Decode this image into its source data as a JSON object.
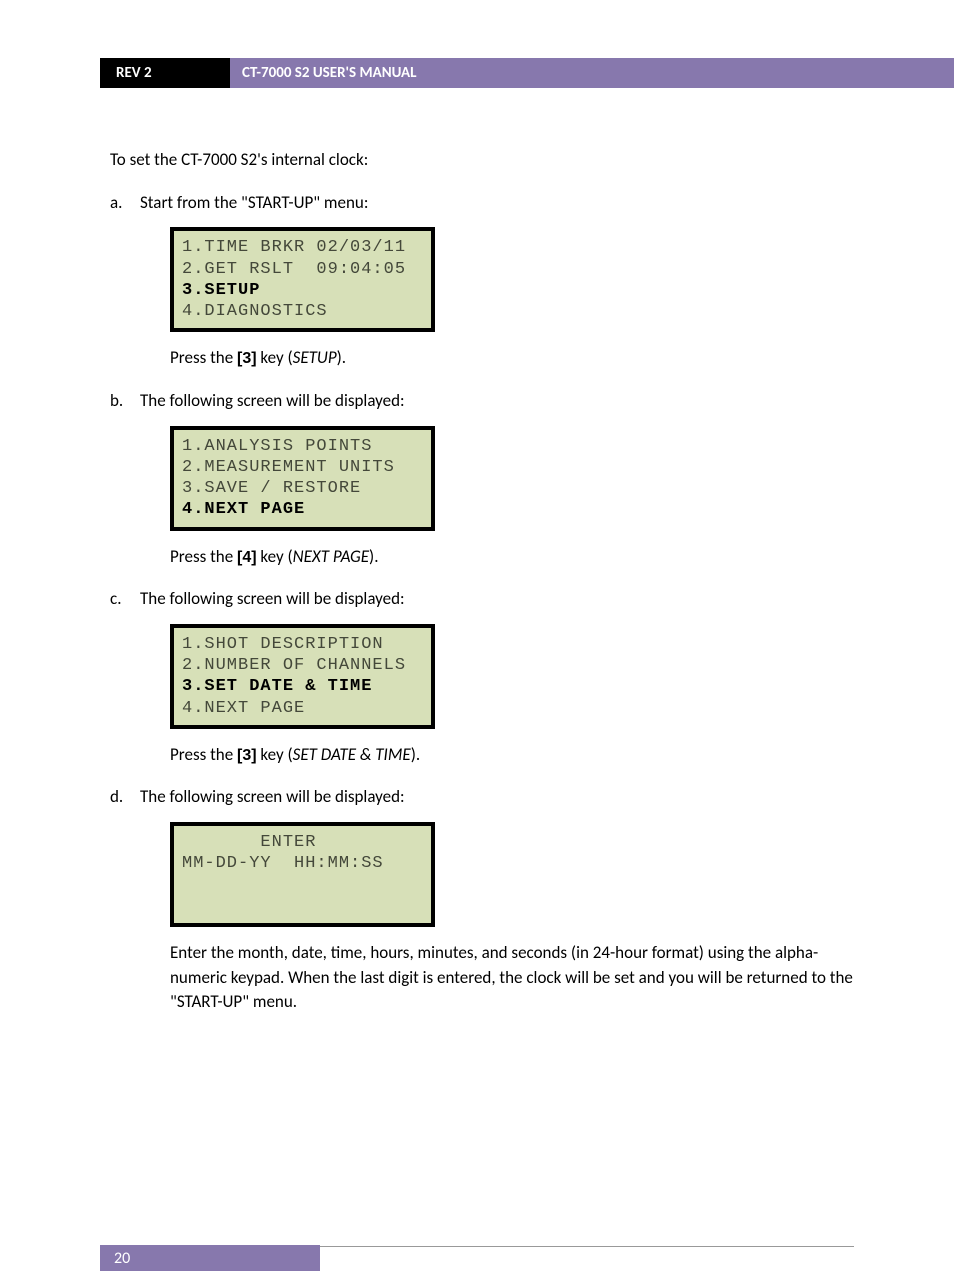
{
  "header": {
    "rev": "REV 2",
    "title": "CT-7000 S2 USER'S MANUAL"
  },
  "intro": "To set the CT-7000 S2's internal clock:",
  "steps": {
    "a": {
      "letter": "a.",
      "text": "Start from the \"START-UP\" menu:",
      "lcd": {
        "l1": "1.TIME BRKR 02/03/11",
        "l2": "2.GET RSLT  09:04:05",
        "l3": "3.SETUP",
        "l4": "4.DIAGNOSTICS",
        "bold_line": 3
      },
      "press_pre": "Press the ",
      "key": "[3]",
      "press_mid": " key (",
      "press_opt": "SETUP",
      "press_post": ")."
    },
    "b": {
      "letter": "b.",
      "text": "The following screen will be displayed:",
      "lcd": {
        "l1": "1.ANALYSIS POINTS",
        "l2": "2.MEASUREMENT UNITS",
        "l3": "3.SAVE / RESTORE",
        "l4": "4.NEXT PAGE",
        "bold_line": 4
      },
      "press_pre": "Press the ",
      "key": "[4]",
      "press_mid": " key (",
      "press_opt": "NEXT PAGE",
      "press_post": ")."
    },
    "c": {
      "letter": "c.",
      "text": "The following screen will be displayed:",
      "lcd": {
        "l1": "1.SHOT DESCRIPTION",
        "l2": "2.NUMBER OF CHANNELS",
        "l3": "3.SET DATE & TIME",
        "l4": "4.NEXT PAGE",
        "bold_line": 3
      },
      "press_pre": "Press the ",
      "key": "[3]",
      "press_mid": " key (",
      "press_opt": "SET DATE & TIME",
      "press_post": ")."
    },
    "d": {
      "letter": "d.",
      "text": "The following screen will be displayed:",
      "lcd": {
        "l1": "       ENTER",
        "l2": "MM-DD-YY  HH:MM:SS",
        "l3": " ",
        "l4": " ",
        "bold_line": 0
      },
      "final": "Enter the month, date, time, hours, minutes, and seconds (in 24-hour format) using the alpha-numeric keypad. When the last digit is entered, the clock will be set and you will be returned to the \"START-UP\" menu."
    }
  },
  "footer": {
    "page": "20"
  }
}
